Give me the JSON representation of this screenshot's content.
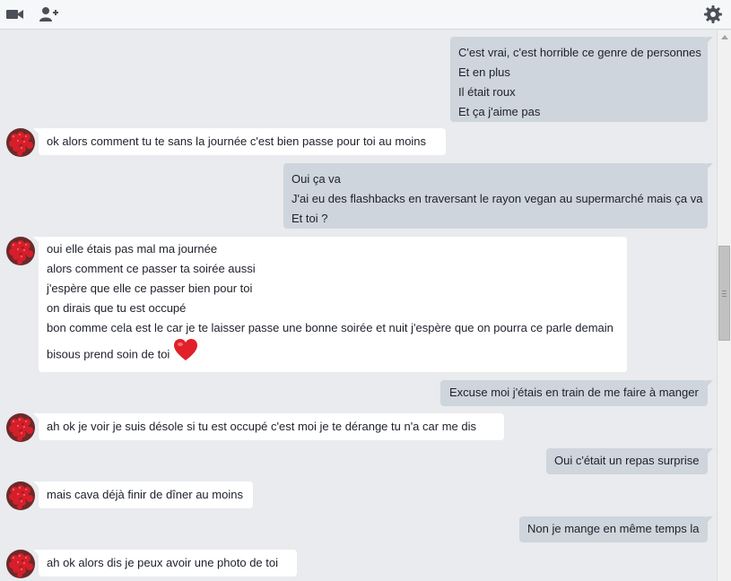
{
  "toolbar": {
    "video_icon": "video-camera-icon",
    "add_person_icon": "add-person-icon",
    "settings_icon": "gear-icon"
  },
  "colors": {
    "outgoing_bubble": "#ced5dc",
    "incoming_bubble": "#ffffff",
    "background": "#e9ebee",
    "heart": "#e0202a"
  },
  "messages": [
    {
      "direction": "out",
      "lines": [
        "C'est vrai, c'est horrible ce genre de personnes",
        "Et en plus",
        "Il était roux",
        "Et ça j'aime pas"
      ]
    },
    {
      "direction": "in",
      "lines": [
        " ok alors comment tu te sans la journée c'est bien passe pour toi au moins"
      ]
    },
    {
      "direction": "out",
      "lines": [
        "Oui ça va",
        "J'ai eu des flashbacks en traversant le rayon vegan au supermarché mais ça va",
        "Et toi ?"
      ]
    },
    {
      "direction": "in",
      "lines": [
        " oui elle étais pas mal ma journée",
        "alors comment ce passer ta soirée aussi",
        " j'espère que elle ce passer bien pour toi",
        "on dirais que tu est occupé",
        "bon comme cela est le car je te laisser passe une bonne soirée et nuit j'espère que on pourra ce parle demain",
        "bisous prend soin de toi"
      ],
      "emoji": "heart-emoji"
    },
    {
      "direction": "out",
      "lines": [
        "Excuse moi j'étais en train de me faire à manger"
      ]
    },
    {
      "direction": "in",
      "lines": [
        "ah ok  je voir  je suis désole si tu est occupé c'est moi je te dérange tu n'a  car me dis"
      ]
    },
    {
      "direction": "out",
      "lines": [
        "Oui c'était un repas surprise"
      ]
    },
    {
      "direction": "in",
      "lines": [
        "mais cava déjà finir de dîner au moins"
      ]
    },
    {
      "direction": "out",
      "lines": [
        "Non je mange en même temps la"
      ]
    },
    {
      "direction": "in",
      "lines": [
        " ah ok  alors dis je peux avoir une photo de toi"
      ]
    }
  ]
}
